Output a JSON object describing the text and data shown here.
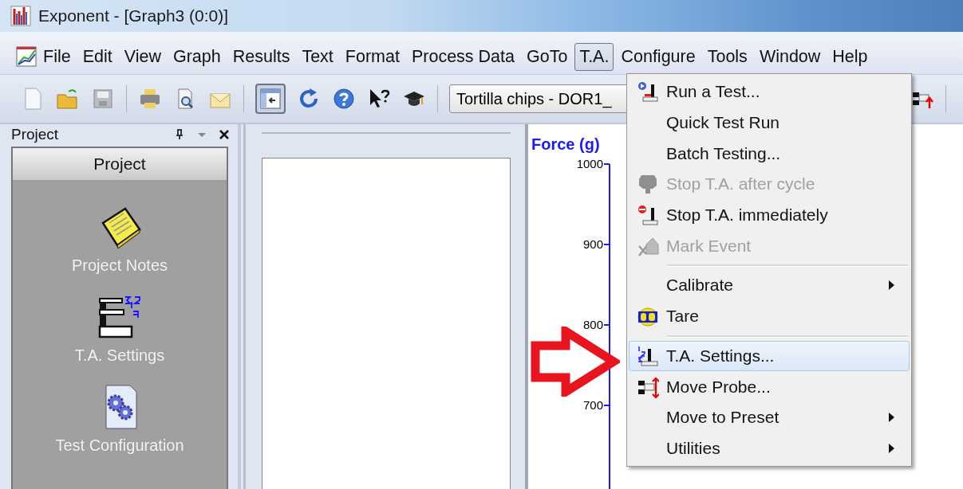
{
  "window": {
    "title": "Exponent - [Graph3 (0:0)]"
  },
  "menu_bar": [
    {
      "label": "File",
      "selected": false
    },
    {
      "label": "Edit",
      "selected": false
    },
    {
      "label": "View",
      "selected": false
    },
    {
      "label": "Graph",
      "selected": false
    },
    {
      "label": "Results",
      "selected": false
    },
    {
      "label": "Text",
      "selected": false
    },
    {
      "label": "Format",
      "selected": false
    },
    {
      "label": "Process Data",
      "selected": false
    },
    {
      "label": "GoTo",
      "selected": false
    },
    {
      "label": "T.A.",
      "selected": true
    },
    {
      "label": "Configure",
      "selected": false
    },
    {
      "label": "Tools",
      "selected": false
    },
    {
      "label": "Window",
      "selected": false
    },
    {
      "label": "Help",
      "selected": false
    }
  ],
  "toolbar": {
    "test_selector": {
      "value": "Tortilla chips - DOR1_"
    }
  },
  "project_panel": {
    "title": "Project",
    "header": "Project",
    "items": [
      {
        "label": "Project Notes",
        "kind": "notes"
      },
      {
        "label": "T.A. Settings",
        "kind": "settings"
      },
      {
        "label": "Test Configuration",
        "kind": "config"
      }
    ]
  },
  "graph": {
    "y_axis": {
      "title": "Force (g)",
      "ticks": [
        "1000",
        "900",
        "800",
        "700"
      ]
    }
  },
  "ta_menu": {
    "items": [
      {
        "kind": "item",
        "label": "Run a Test...",
        "disabled": false,
        "submenu": false,
        "selected": false
      },
      {
        "kind": "item",
        "label": "Quick Test Run",
        "disabled": false,
        "submenu": false,
        "selected": false
      },
      {
        "kind": "item",
        "label": "Batch Testing...",
        "disabled": false,
        "submenu": false,
        "selected": false
      },
      {
        "kind": "item",
        "label": "Stop T.A. after cycle",
        "disabled": true,
        "submenu": false,
        "selected": false
      },
      {
        "kind": "item",
        "label": "Stop T.A. immediately",
        "disabled": false,
        "submenu": false,
        "selected": false
      },
      {
        "kind": "item",
        "label": "Mark Event",
        "disabled": true,
        "submenu": false,
        "selected": false
      },
      {
        "kind": "separator"
      },
      {
        "kind": "item",
        "label": "Calibrate",
        "disabled": false,
        "submenu": true,
        "selected": false
      },
      {
        "kind": "item",
        "label": "Tare",
        "disabled": false,
        "submenu": false,
        "selected": false
      },
      {
        "kind": "separator"
      },
      {
        "kind": "item",
        "label": "T.A. Settings...",
        "disabled": false,
        "submenu": false,
        "selected": true
      },
      {
        "kind": "item",
        "label": "Move Probe...",
        "disabled": false,
        "submenu": false,
        "selected": false
      },
      {
        "kind": "item",
        "label": "Move to Preset",
        "disabled": false,
        "submenu": true,
        "selected": false
      },
      {
        "kind": "item",
        "label": "Utilities",
        "disabled": false,
        "submenu": true,
        "selected": false
      }
    ]
  }
}
